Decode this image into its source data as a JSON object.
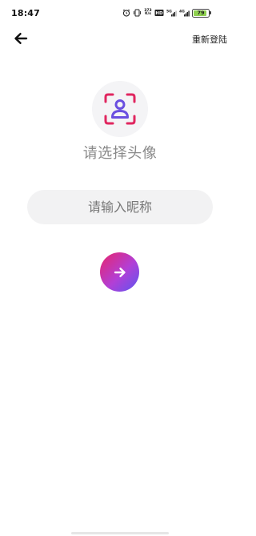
{
  "status_bar": {
    "time": "18:47",
    "battery_level": "79",
    "speed_label": "373 K/s",
    "network_label": "4G",
    "icons": [
      "alarm-icon",
      "vibrate-icon",
      "speed-indicator",
      "hd-icon",
      "signal-5g-icon",
      "signal-4g-icon",
      "battery-icon"
    ],
    "battery_color": "#8fd14f"
  },
  "header": {
    "back_icon": "arrow-left-icon",
    "relogin_label": "重新登陆"
  },
  "avatar": {
    "icon": "person-frame-icon",
    "label": "请选择头像",
    "icon_color_person": "#6a4fe0",
    "icon_color_frame": "#e0265f"
  },
  "nickname": {
    "placeholder": "请输入昵称",
    "value": ""
  },
  "submit": {
    "icon": "arrow-right-icon",
    "gradient": [
      "#e8256b",
      "#b23fd6",
      "#5c55f0"
    ]
  }
}
